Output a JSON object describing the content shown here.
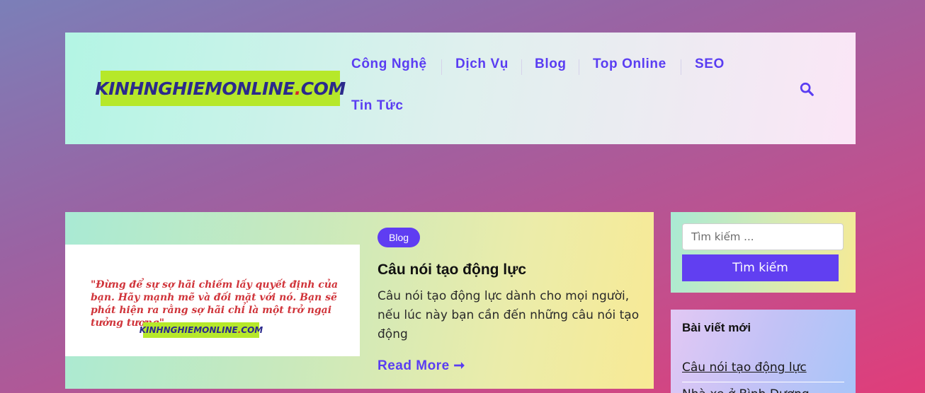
{
  "site": {
    "logo_text": "KINHNGHIEMONLINE",
    "logo_dot": ".",
    "logo_tld": "COM"
  },
  "nav": {
    "items": [
      {
        "label": "Công Nghệ"
      },
      {
        "label": "Dịch Vụ"
      },
      {
        "label": "Blog"
      },
      {
        "label": "Top Online"
      },
      {
        "label": "SEO"
      },
      {
        "label": "Tin Tức"
      }
    ],
    "search_icon": "search-icon"
  },
  "post": {
    "category": "Blog",
    "title": "Câu nói tạo động lực",
    "excerpt": "Câu nói tạo động lực dành cho mọi người, nếu lúc này bạn cần đến những câu nói tạo động",
    "read_more": "Read More ➞",
    "thumbnail": {
      "quote": "\"Đừng để sự sợ hãi chiếm lấy quyết định của bạn. Hãy mạnh mẽ và đối mặt với nó. Bạn sẽ phát hiện ra rằng sợ hãi chỉ là một trở ngại tưởng tượng\"",
      "logo_text": "KINHNGHIEMONLINE",
      "logo_dot": ".",
      "logo_tld": "COM"
    }
  },
  "sidebar": {
    "search": {
      "placeholder": "Tìm kiếm ...",
      "button_label": "Tìm kiếm"
    },
    "recent": {
      "title": "Bài viết mới",
      "items": [
        {
          "label": "Câu nói tạo động lực"
        },
        {
          "label": "Nhà xe ở Bình Dương"
        }
      ]
    }
  },
  "colors": {
    "accent": "#5f3df2",
    "logo_bg": "#b6e82a",
    "logo_text": "#2b2a8c",
    "logo_dot": "#d7262b"
  }
}
